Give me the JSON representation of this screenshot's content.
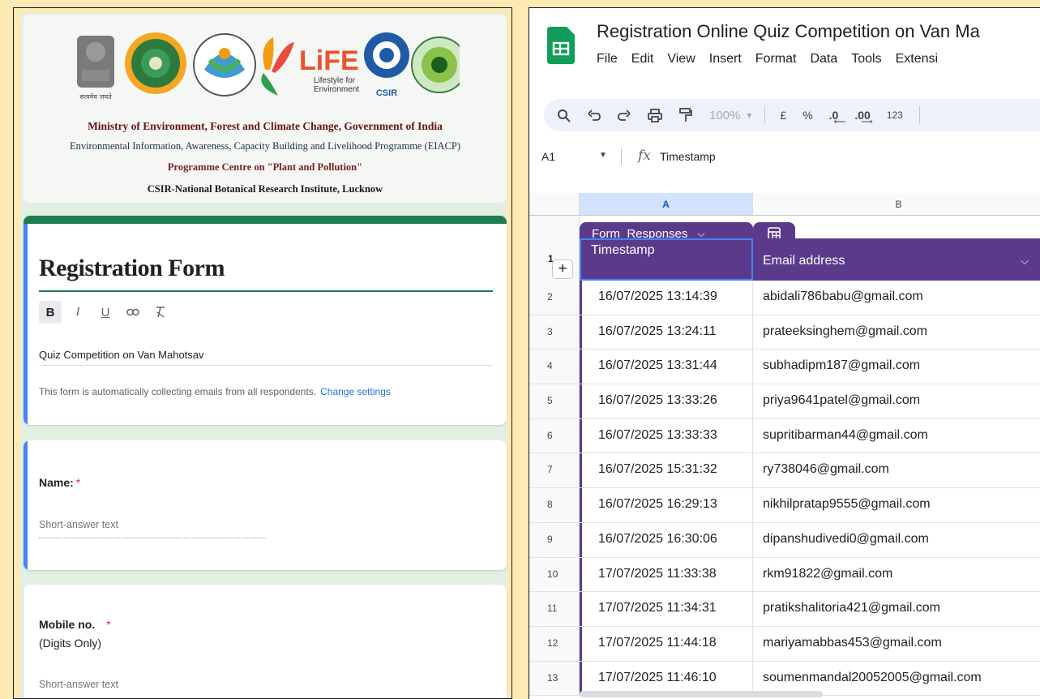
{
  "form": {
    "header": {
      "line1": "Ministry of Environment, Forest and Climate Change, Government of India",
      "line2": "Environmental Information, Awareness, Capacity Building and Livelihood Programme (EIACP)",
      "line3": "Programme Centre on \"Plant and Pollution\"",
      "line4": "CSIR-National Botanical Research Institute, Lucknow",
      "logo_life_text": "LiFE",
      "logo_life_sub1": "Lifestyle for",
      "logo_life_sub2": "Environment",
      "logo_csir_text": "CSIR",
      "emblem_caption": "सत्यमेव जयते"
    },
    "title": "Registration Form",
    "format_buttons": [
      "B",
      "I",
      "U",
      "link",
      "clear-format"
    ],
    "description": "Quiz Competition on Van Mahotsav",
    "collect_note": "This form is automatically collecting emails from all respondents.",
    "collect_link": "Change settings",
    "questions": [
      {
        "label": "Name:",
        "required_mark": "*",
        "placeholder": "Short-answer text"
      },
      {
        "label": "Mobile no.",
        "required_mark": "*",
        "sub": "(Digits Only)",
        "placeholder": "Short-answer text"
      }
    ],
    "colors": {
      "accent_green": "#1e7d4f",
      "focus_blue": "#4285f4"
    }
  },
  "sheets": {
    "doc_title": "Registration Online Quiz Competition on Van Ma",
    "menu": [
      "File",
      "Edit",
      "View",
      "Insert",
      "Format",
      "Data",
      "Tools",
      "Extensi"
    ],
    "toolbar": {
      "zoom": "100%",
      "currency": "£",
      "percent": "%",
      "dec_dec": ".0",
      "dec_inc": ".00",
      "number_fmt": "123"
    },
    "cell_ref": "A1",
    "formula_value": "Timestamp",
    "columns": [
      "A",
      "B"
    ],
    "table_name": "Form_Responses",
    "header_row_num": "1",
    "headers": [
      "Timestamp",
      "Email address"
    ],
    "rows": [
      {
        "n": "2",
        "ts": "16/07/2025 13:14:39",
        "email": "abidali786babu@gmail.com"
      },
      {
        "n": "3",
        "ts": "16/07/2025 13:24:11",
        "email": "prateeksinghem@gmail.com"
      },
      {
        "n": "4",
        "ts": "16/07/2025 13:31:44",
        "email": "subhadipm187@gmail.com"
      },
      {
        "n": "5",
        "ts": "16/07/2025 13:33:26",
        "email": "priya9641patel@gmail.com"
      },
      {
        "n": "6",
        "ts": "16/07/2025 13:33:33",
        "email": "supritibarman44@gmail.com"
      },
      {
        "n": "7",
        "ts": "16/07/2025 15:31:32",
        "email": "ry738046@gmail.com"
      },
      {
        "n": "8",
        "ts": "16/07/2025 16:29:13",
        "email": "nikhilpratap9555@gmail.com"
      },
      {
        "n": "9",
        "ts": "16/07/2025 16:30:06",
        "email": "dipanshudivedi0@gmail.com"
      },
      {
        "n": "10",
        "ts": "17/07/2025 11:33:38",
        "email": "rkm91822@gmail.com"
      },
      {
        "n": "11",
        "ts": "17/07/2025 11:34:31",
        "email": "pratikshalitoria421@gmail.com"
      },
      {
        "n": "12",
        "ts": "17/07/2025 11:44:18",
        "email": "mariyamabbas453@gmail.com"
      },
      {
        "n": "13",
        "ts": "17/07/2025 11:46:10",
        "email": "soumenmandal20052005@gmail.com"
      }
    ],
    "colors": {
      "table_purple": "#5b3a8c",
      "selected_col": "#d3e3fd",
      "sheets_green": "#0f9d58"
    }
  }
}
